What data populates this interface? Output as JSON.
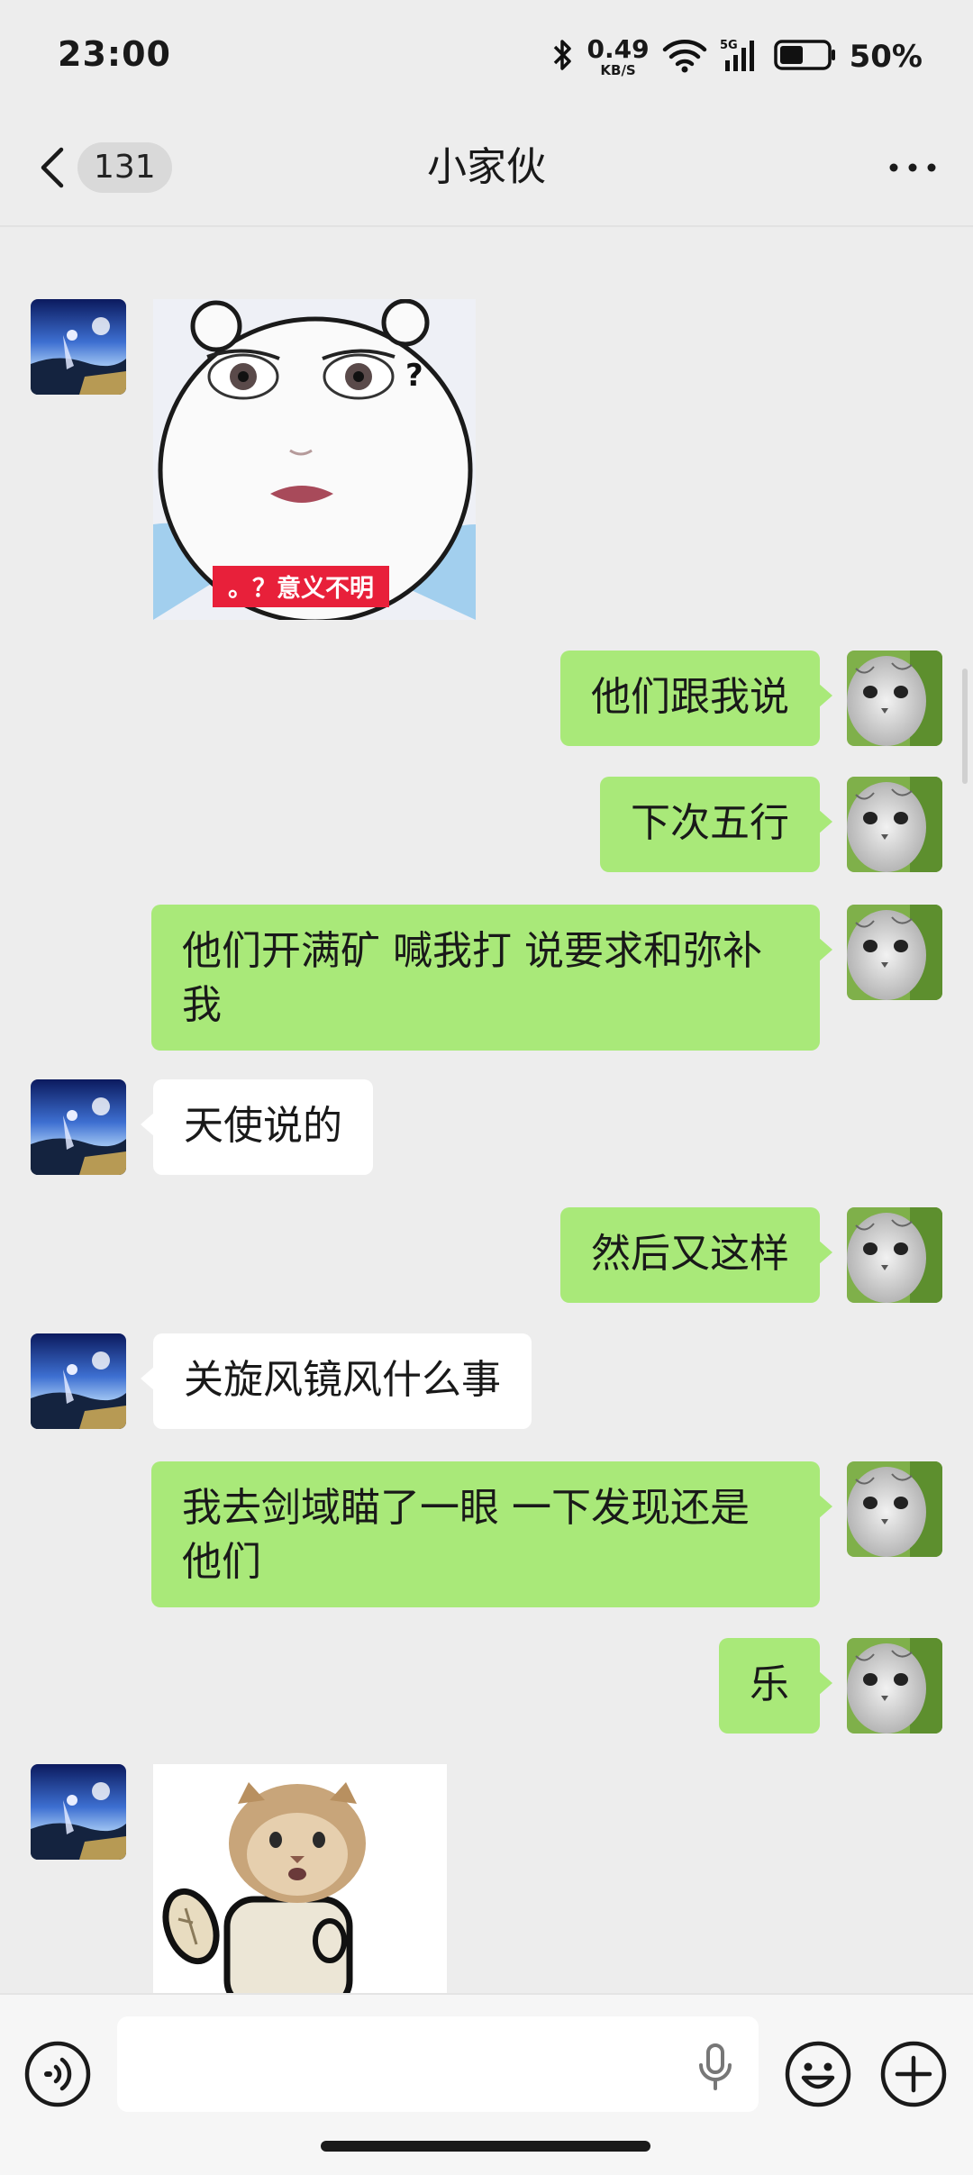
{
  "status_bar": {
    "time": "23:00",
    "net_speed_value": "0.49",
    "net_speed_unit": "KB/S",
    "network_type": "5G",
    "battery_percent": "50%",
    "battery_level": 0.5
  },
  "header": {
    "unread_count": "131",
    "title": "小家伙"
  },
  "messages": [
    {
      "side": "other",
      "type": "sticker",
      "caption": "。？意义不明",
      "mark": "?"
    },
    {
      "side": "me",
      "type": "text",
      "text": "他们跟我说"
    },
    {
      "side": "me",
      "type": "text",
      "text": "下次五行"
    },
    {
      "side": "me",
      "type": "text",
      "line1": "他们开满矿 喊我打 说要求和弥补",
      "line2": "我"
    },
    {
      "side": "other",
      "type": "text",
      "text": "天使说的"
    },
    {
      "side": "me",
      "type": "text",
      "text": "然后又这样"
    },
    {
      "side": "other",
      "type": "text",
      "text": "关旋风镜风什么事"
    },
    {
      "side": "me",
      "type": "text",
      "line1": "我去剑域瞄了一眼 一下发现还是",
      "line2": "他们"
    },
    {
      "side": "me",
      "type": "text",
      "text": "乐"
    },
    {
      "side": "other",
      "type": "sticker",
      "description_icon": "cat-sticker"
    }
  ],
  "colors": {
    "my_bubble": "#a9e979",
    "other_bubble": "#ffffff",
    "background": "#ededed"
  },
  "input": {
    "value": "",
    "placeholder": ""
  },
  "icons": {
    "back": "chevron-left-icon",
    "more": "more-dots-icon",
    "voice": "voice-icon",
    "mic": "mic-icon",
    "emoji": "emoji-icon",
    "plus": "plus-icon"
  }
}
